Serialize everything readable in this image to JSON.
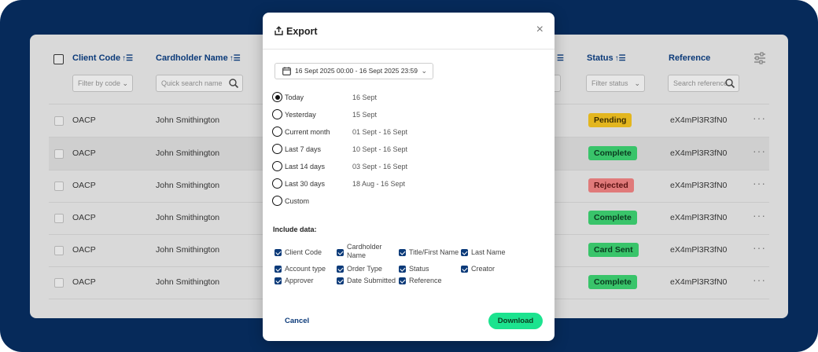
{
  "table": {
    "columns": {
      "client_code": "Client Code",
      "cardholder_name": "Cardholder Name",
      "status": "Status",
      "reference": "Reference"
    },
    "filters": {
      "client_code_placeholder": "Filter by code",
      "cardholder_placeholder": "Quick search name",
      "status_placeholder": "Filter status",
      "reference_placeholder": "Search reference"
    },
    "rows": [
      {
        "code": "OACP",
        "name": "John Smithington",
        "status": "Pending",
        "reference": "eX4mPl3R3fN0"
      },
      {
        "code": "OACP",
        "name": "John Smithington",
        "status": "Complete",
        "reference": "eX4mPl3R3fN0"
      },
      {
        "code": "OACP",
        "name": "John Smithington",
        "status": "Rejected",
        "reference": "eX4mPl3R3fN0"
      },
      {
        "code": "OACP",
        "name": "John Smithington",
        "status": "Complete",
        "reference": "eX4mPl3R3fN0"
      },
      {
        "code": "OACP",
        "name": "John Smithington",
        "status": "Card Sent",
        "reference": "eX4mPl3R3fN0"
      },
      {
        "code": "OACP",
        "name": "John Smithington",
        "status": "Complete",
        "reference": "eX4mPl3R3fN0"
      }
    ],
    "more_glyph": "···"
  },
  "modal": {
    "title": "Export",
    "close_glyph": "×",
    "date_range": "16 Sept 2025 00:00 - 16 Sept 2025 23:59",
    "options": [
      {
        "label": "Today",
        "range": "16 Sept",
        "selected": true
      },
      {
        "label": "Yesterday",
        "range": "15 Sept",
        "selected": false
      },
      {
        "label": "Current month",
        "range": "01 Sept - 16 Sept",
        "selected": false
      },
      {
        "label": "Last 7 days",
        "range": "10 Sept - 16 Sept",
        "selected": false
      },
      {
        "label": "Last 14 days",
        "range": "03 Sept - 16 Sept",
        "selected": false
      },
      {
        "label": "Last 30 days",
        "range": "18 Aug - 16 Sept",
        "selected": false
      },
      {
        "label": "Custom",
        "range": "",
        "selected": false
      }
    ],
    "include_title": "Include data:",
    "include": [
      {
        "label": "Client Code",
        "checked": true
      },
      {
        "label": "Cardholder Name",
        "checked": true
      },
      {
        "label": "Title/First Name",
        "checked": true
      },
      {
        "label": "Last Name",
        "checked": true
      },
      {
        "label": "Account type",
        "checked": true
      },
      {
        "label": "Order Type",
        "checked": true
      },
      {
        "label": "Status",
        "checked": true
      },
      {
        "label": "Creator",
        "checked": true
      },
      {
        "label": "Approver",
        "checked": true
      },
      {
        "label": "Date Submitted",
        "checked": true
      },
      {
        "label": "Reference",
        "checked": true
      }
    ],
    "cancel_label": "Cancel",
    "download_label": "Download"
  },
  "colors": {
    "frame_bg": "#062a5a",
    "accent_blue": "#0b3a79",
    "download_green": "#1ce38f",
    "status_pending": "#e3b61e",
    "status_complete": "#39c46a",
    "status_rejected": "#e07a7a"
  },
  "icons": {
    "export": "export-icon",
    "close": "close-icon",
    "calendar": "calendar-icon",
    "chevron": "chevron-down-icon",
    "search": "search-icon",
    "sort": "sort-icon",
    "settings": "column-settings-icon",
    "more": "more-icon"
  }
}
